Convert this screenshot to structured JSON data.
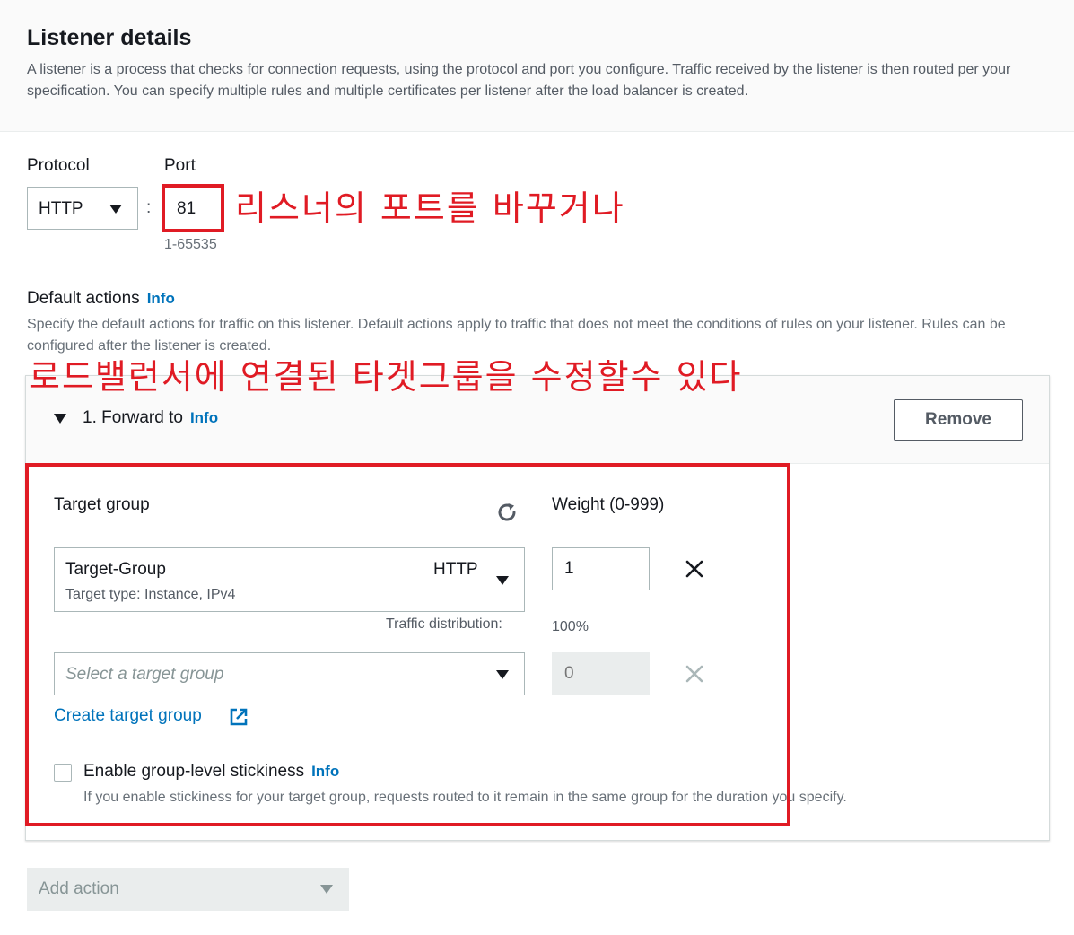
{
  "header": {
    "title": "Listener details",
    "description": "A listener is a process that checks for connection requests, using the protocol and port you configure. Traffic received by the listener is then routed per your specification. You can specify multiple rules and multiple certificates per listener after the load balancer is created."
  },
  "listener": {
    "protocol_label": "Protocol",
    "protocol_value": "HTTP",
    "colon": ":",
    "port_label": "Port",
    "port_value": "81",
    "port_hint": "1-65535"
  },
  "default_actions": {
    "label": "Default actions",
    "info": "Info",
    "description": "Specify the default actions for traffic on this listener. Default actions apply to traffic that does not meet the conditions of rules on your listener. Rules can be configured after the listener is created."
  },
  "forward": {
    "label": "1. Forward to",
    "info": "Info",
    "remove_label": "Remove",
    "target_group_label": "Target group",
    "weight_label": "Weight (0-999)",
    "group1": {
      "name": "Target-Group",
      "type": "Target type: Instance, IPv4",
      "protocol": "HTTP",
      "weight": "1"
    },
    "traffic_distribution_label": "Traffic distribution:",
    "traffic_distribution_value": "100%",
    "group2": {
      "placeholder": "Select a target group",
      "weight_placeholder": "0"
    },
    "create_link": "Create target group",
    "stickiness_label": "Enable group-level stickiness",
    "stickiness_info": "Info",
    "stickiness_desc": "If you enable stickiness for your target group, requests routed to it remain in the same group for the duration you specify."
  },
  "add_action": {
    "label": "Add action"
  },
  "annotations": {
    "port_note": "리스너의 포트를 바꾸거나",
    "target_note": "로드밸런서에 연결된 타겟그룹을 수정할수 있다"
  },
  "colors": {
    "accent": "#0073bb",
    "annotation": "#e01b24"
  }
}
